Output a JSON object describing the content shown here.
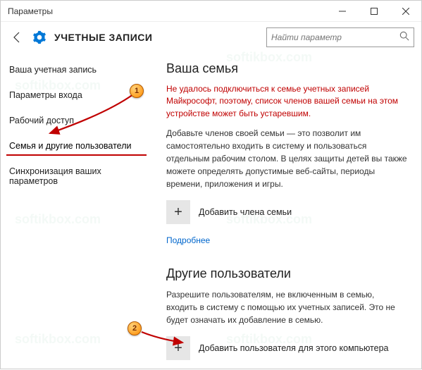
{
  "window": {
    "title": "Параметры"
  },
  "header": {
    "title": "УЧЕТНЫЕ ЗАПИСИ"
  },
  "search": {
    "placeholder": "Найти параметр"
  },
  "sidebar": {
    "items": [
      {
        "label": "Ваша учетная запись"
      },
      {
        "label": "Параметры входа"
      },
      {
        "label": "Рабочий доступ"
      },
      {
        "label": "Семья и другие пользователи"
      },
      {
        "label": "Синхронизация ваших параметров"
      }
    ],
    "active_index": 3
  },
  "family": {
    "heading": "Ваша семья",
    "error": "Не удалось подключиться к семье учетных записей Майкрософт, поэтому, список членов вашей семьи на этом устройстве может быть устаревшим.",
    "desc": "Добавьте членов своей семьи — это позволит им самостоятельно входить в систему и пользоваться отдельным рабочим столом. В целях защиты детей вы также можете определять допустимые веб-сайты, периоды времени, приложения и игры.",
    "add_label": "Добавить члена семьи",
    "more": "Подробнее"
  },
  "others": {
    "heading": "Другие пользователи",
    "desc": "Разрешите пользователям, не включенным в семью, входить в систему с помощью их учетных записей. Это не будет означать их добавление в семью.",
    "add_label": "Добавить пользователя для этого компьютера"
  },
  "annotations": {
    "step1": "1",
    "step2": "2"
  },
  "watermark": "softikbox.com"
}
